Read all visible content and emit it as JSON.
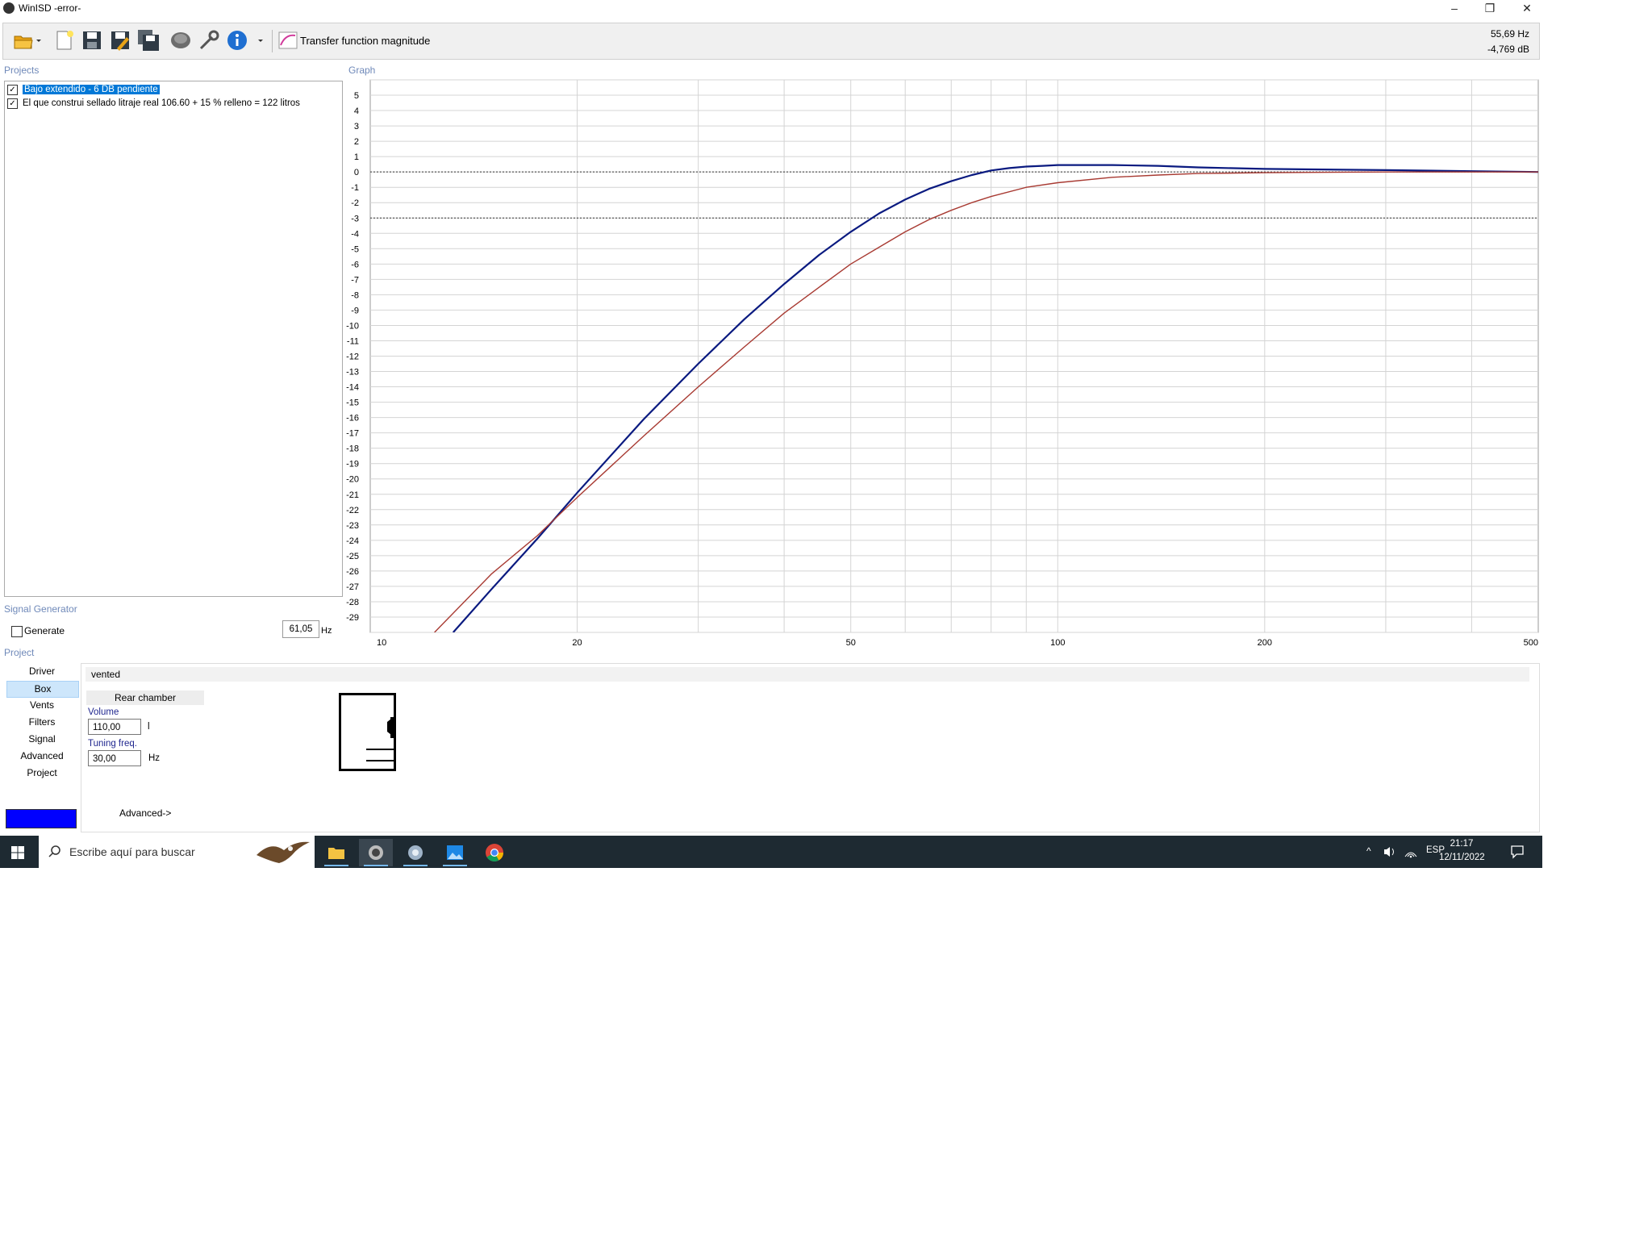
{
  "window": {
    "title": "WinISD -error-",
    "minimize_glyph": "–",
    "restore_glyph": "❐",
    "close_glyph": "✕"
  },
  "toolbar": {
    "icons": [
      "open-folder-icon",
      "new-document-icon",
      "save-icon",
      "save-as-icon",
      "save-all-icon",
      "driver-icon",
      "settings-icon",
      "info-icon"
    ],
    "graph_select_label": "Transfer function magnitude",
    "readout_freq": "55,69 Hz",
    "readout_level": "-4,769 dB"
  },
  "projects": {
    "header": "Projects",
    "items": [
      {
        "label": "Bajo extendido - 6 DB pendiente",
        "checked": true,
        "selected": true
      },
      {
        "label": "El que construi sellado litraje real 106.60 + 15 % relleno = 122 litros",
        "checked": true,
        "selected": false
      }
    ]
  },
  "graph": {
    "header": "Graph"
  },
  "signal_generator": {
    "header": "Signal Generator",
    "generate_label": "Generate",
    "frequency_value": "61,05",
    "frequency_unit": "Hz"
  },
  "project_section": {
    "header": "Project",
    "nav": [
      "Driver",
      "Box",
      "Vents",
      "Filters",
      "Signal",
      "Advanced",
      "Project"
    ],
    "selected_nav": "Box",
    "box_type": "vented",
    "chamber_tab": "Rear chamber",
    "volume_label": "Volume",
    "volume_value": "110,00",
    "volume_unit": "l",
    "tuning_label": "Tuning freq.",
    "tuning_value": "30,00",
    "tuning_unit": "Hz",
    "advanced_link": "Advanced->",
    "color_swatch": "#0000ff"
  },
  "taskbar": {
    "search_placeholder": "Escribe aquí para buscar",
    "apps": [
      "file-explorer-icon",
      "winisd-icon",
      "app-icon",
      "photos-icon",
      "chrome-icon"
    ],
    "language": "ESP",
    "time": "21:17",
    "date": "12/11/2022"
  },
  "chart_data": {
    "type": "line",
    "x_scale": "log",
    "xlim": [
      10,
      500
    ],
    "ylim": [
      -30,
      6
    ],
    "x_ticks": [
      10,
      20,
      50,
      100,
      200,
      500
    ],
    "y_ticks": [
      5,
      4,
      3,
      2,
      1,
      0,
      -1,
      -2,
      -3,
      -4,
      -5,
      -6,
      -7,
      -8,
      -9,
      -10,
      -11,
      -12,
      -13,
      -14,
      -15,
      -16,
      -17,
      -18,
      -19,
      -20,
      -21,
      -22,
      -23,
      -24,
      -25,
      -26,
      -27,
      -28,
      -29
    ],
    "reference_lines": [
      0,
      -3
    ],
    "grid": true,
    "series": [
      {
        "color": "#0a1a80",
        "x": [
          13.2,
          15,
          17.5,
          20,
          25,
          30,
          35,
          40,
          45,
          50,
          55,
          60,
          65,
          70,
          75,
          80,
          85,
          90,
          95,
          100,
          110,
          120,
          140,
          160,
          200,
          300,
          400,
          500
        ],
        "y": [
          -30,
          -27.2,
          -23.9,
          -20.9,
          -16.1,
          -12.5,
          -9.6,
          -7.3,
          -5.4,
          -3.9,
          -2.7,
          -1.8,
          -1.1,
          -0.6,
          -0.2,
          0.1,
          0.25,
          0.35,
          0.4,
          0.45,
          0.45,
          0.45,
          0.4,
          0.3,
          0.2,
          0.12,
          0.05,
          0.0
        ]
      },
      {
        "color": "#a83a32",
        "x": [
          12.4,
          15,
          17.5,
          20,
          25,
          30,
          35,
          40,
          45,
          50,
          55,
          60,
          65,
          70,
          75,
          80,
          90,
          100,
          120,
          140,
          160,
          200,
          300,
          500
        ],
        "y": [
          -30,
          -26.2,
          -23.7,
          -21.2,
          -17.2,
          -14.0,
          -11.4,
          -9.2,
          -7.5,
          -6.0,
          -4.9,
          -3.9,
          -3.1,
          -2.5,
          -2.0,
          -1.6,
          -1.0,
          -0.7,
          -0.35,
          -0.2,
          -0.1,
          -0.05,
          0.0,
          0.0
        ]
      }
    ]
  }
}
